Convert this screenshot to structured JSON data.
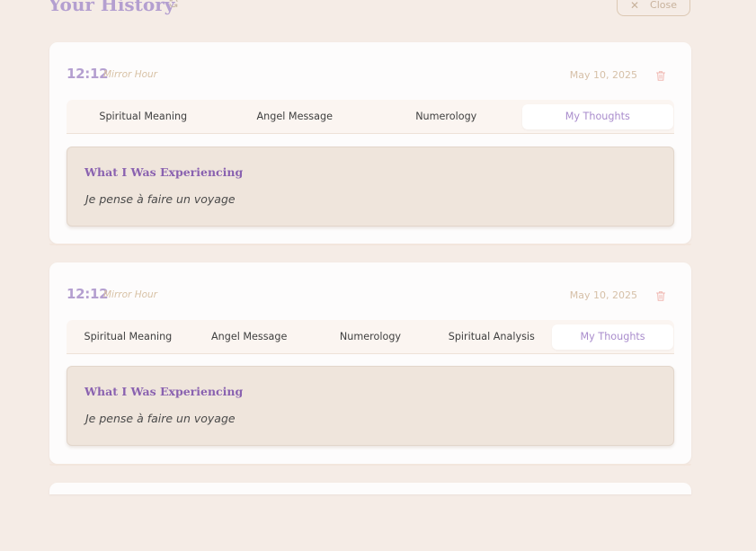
{
  "header": {
    "title": "Your History",
    "refresh_icon": "refresh-icon",
    "close_label": "Close",
    "close_icon": "close-icon"
  },
  "entries": [
    {
      "time": "12:12",
      "kind": "Mirror Hour",
      "date": "May 10, 2025",
      "tabs": [
        "Spiritual Meaning",
        "Angel Message",
        "Numerology",
        "My Thoughts"
      ],
      "active_tab": "My Thoughts",
      "thoughts_title": "What I Was Experiencing",
      "thoughts_text": "Je pense à faire un voyage"
    },
    {
      "time": "12:12",
      "kind": "Mirror Hour",
      "date": "May 10, 2025",
      "tabs": [
        "Spiritual Meaning",
        "Angel Message",
        "Numerology",
        "Spiritual Analysis",
        "My Thoughts"
      ],
      "active_tab": "My Thoughts",
      "thoughts_title": "What I Was Experiencing",
      "thoughts_text": "Je pense à faire un voyage"
    }
  ],
  "colors": {
    "background": "#f5ece6",
    "accent_purple": "#b49fd0",
    "heading_purple": "#8a62b0",
    "muted_tan": "#d6c0a8",
    "trash_pink": "#f0b8b2"
  }
}
